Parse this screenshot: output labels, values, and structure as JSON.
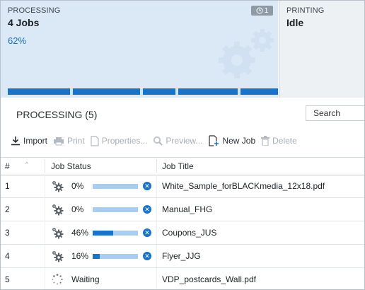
{
  "summary": {
    "processing": {
      "caption": "PROCESSING",
      "jobs": "4 Jobs",
      "percent_text": "62%",
      "badge": "1",
      "queue_segments": [
        0.24,
        0.26,
        0.13,
        0.23,
        0.14
      ]
    },
    "printing": {
      "caption": "PRINTING",
      "status": "Idle"
    }
  },
  "list": {
    "title": "PROCESSING (5)",
    "search_label": "Search"
  },
  "toolbar": {
    "import": "Import",
    "print": "Print",
    "properties": "Properties...",
    "preview": "Preview...",
    "new_job": "New Job",
    "delete": "Delete"
  },
  "columns": {
    "number": "#",
    "status": "Job Status",
    "title": "Job Title"
  },
  "rows": [
    {
      "num": "1",
      "status": "processing",
      "percent": "0%",
      "progress": 0.0,
      "title": "White_Sample_forBLACKmedia_12x18.pdf"
    },
    {
      "num": "2",
      "status": "processing",
      "percent": "0%",
      "progress": 0.0,
      "title": "Manual_FHG"
    },
    {
      "num": "3",
      "status": "processing",
      "percent": "46%",
      "progress": 0.46,
      "title": "Coupons_JUS"
    },
    {
      "num": "4",
      "status": "processing",
      "percent": "16%",
      "progress": 0.16,
      "title": "Flyer_JJG"
    },
    {
      "num": "5",
      "status": "waiting",
      "status_text": "Waiting",
      "title": "VDP_postcards_Wall.pdf"
    }
  ],
  "colors": {
    "accent": "#1a73c6",
    "track": "#a9cdef",
    "panel_processing": "#dbe9f6",
    "panel_printing": "#eef1f4"
  }
}
